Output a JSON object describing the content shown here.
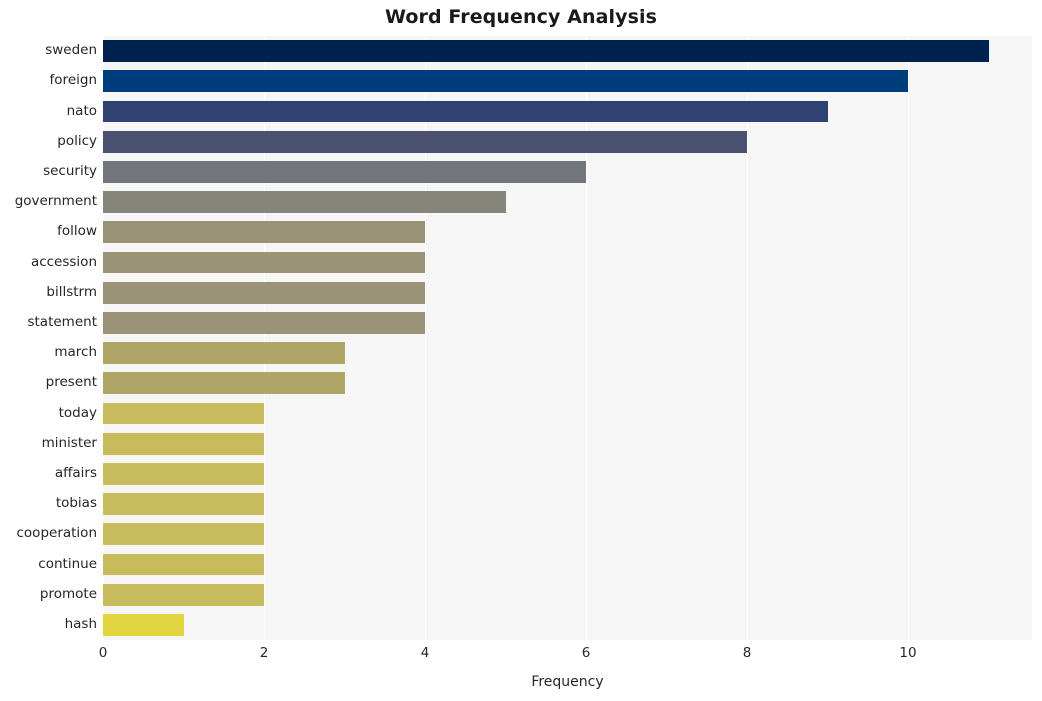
{
  "chart_data": {
    "type": "bar",
    "orientation": "horizontal",
    "title": "Word Frequency Analysis",
    "xlabel": "Frequency",
    "ylabel": "",
    "xlim": [
      0,
      11.54
    ],
    "xticks": [
      0,
      2,
      4,
      6,
      8,
      10
    ],
    "xticklabels": [
      "0",
      "2",
      "4",
      "6",
      "8",
      "10"
    ],
    "grid": "vertical-only",
    "legend": "none",
    "categories": [
      "sweden",
      "foreign",
      "nato",
      "policy",
      "security",
      "government",
      "follow",
      "accession",
      "billstrm",
      "statement",
      "march",
      "present",
      "today",
      "minister",
      "affairs",
      "tobias",
      "cooperation",
      "continue",
      "promote",
      "hash"
    ],
    "values": [
      11,
      10,
      9,
      8,
      6,
      5,
      4,
      4,
      4,
      4,
      3,
      3,
      2,
      2,
      2,
      2,
      2,
      2,
      2,
      1
    ],
    "bar_colors": [
      "#00224e",
      "#003d7c",
      "#2f4372",
      "#4a5170",
      "#72757b",
      "#86857a",
      "#9a9378",
      "#9a9378",
      "#9a9378",
      "#9a9378",
      "#b0a667",
      "#b0a667",
      "#c7bb5c",
      "#c7bb5c",
      "#c7bb5c",
      "#c7bb5c",
      "#c7bb5c",
      "#c7bb5c",
      "#c7bb5c",
      "#e3d53f"
    ],
    "plot_background": "#f6f6f6",
    "figure_background": "#ffffff",
    "gridline_color": "#ffffff",
    "text_color": "#262626"
  }
}
